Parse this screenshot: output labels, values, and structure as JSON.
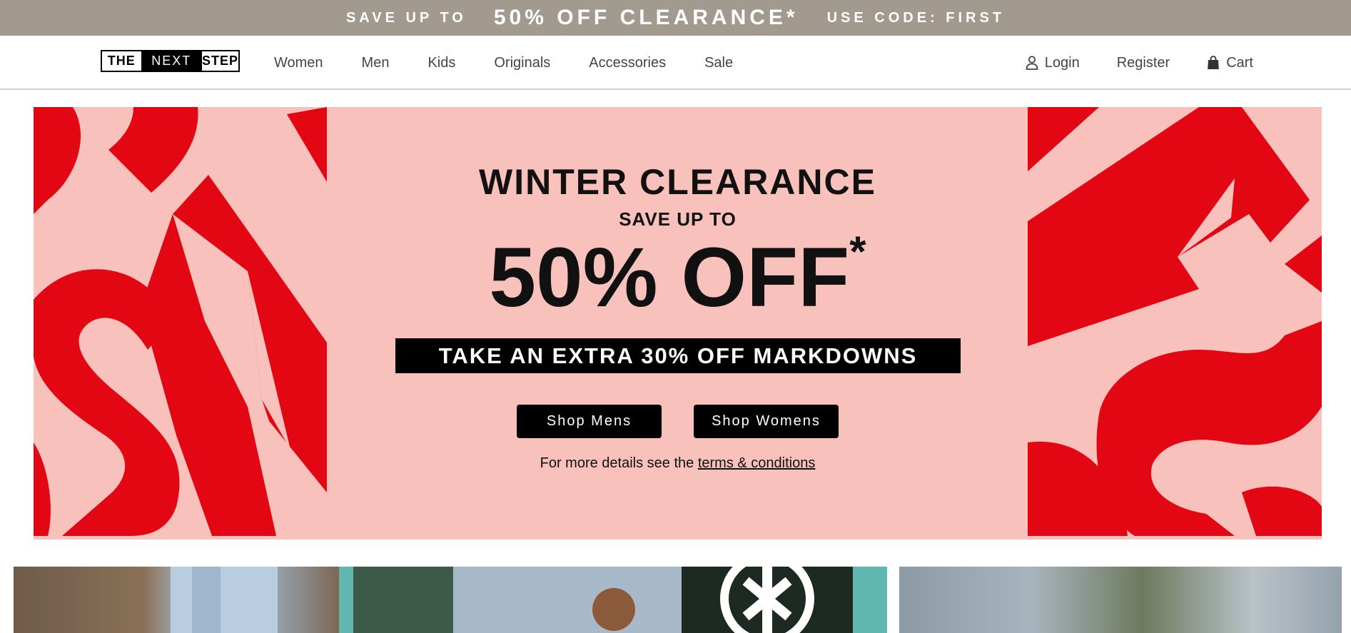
{
  "promo": {
    "prefix": "SAVE UP TO",
    "headline": "50% OFF CLEARANCE*",
    "code": "USE CODE: FIRST"
  },
  "header": {
    "logo": {
      "part1": "THE",
      "part2": "NEXT",
      "part3": "STEP"
    },
    "nav": [
      "Women",
      "Men",
      "Kids",
      "Originals",
      "Accessories",
      "Sale"
    ],
    "account": {
      "login": "Login",
      "register": "Register",
      "cart": "Cart"
    }
  },
  "hero": {
    "title": "WINTER CLEARANCE",
    "subtitle": "SAVE UP TO",
    "discount": "50% OFF",
    "asterisk": "*",
    "extra": "TAKE AN EXTRA 30% OFF MARKDOWNS",
    "button_mens": "Shop Mens",
    "button_womens": "Shop Womens",
    "terms_prefix": "For more details see the",
    "terms_link": "terms & conditions"
  },
  "colors": {
    "promo_bg": "#a29a8f",
    "hero_bg": "#f9c1bc",
    "hero_accent": "#e30613",
    "button_bg": "#000000"
  }
}
